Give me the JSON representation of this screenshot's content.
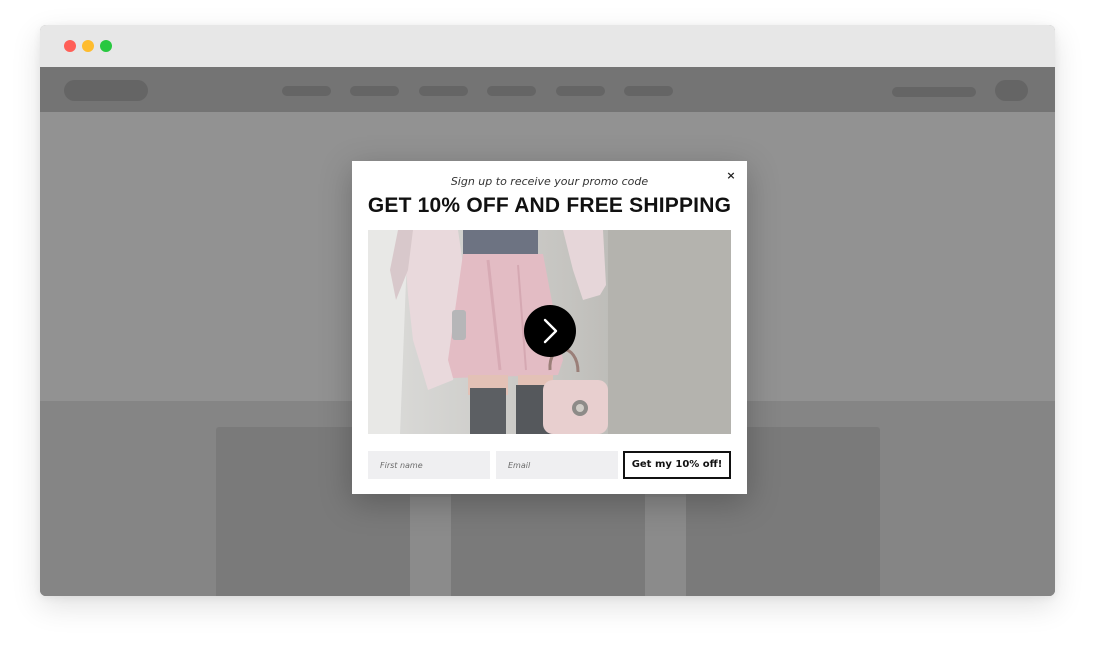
{
  "popup": {
    "subtitle": "Sign up to receive your promo code",
    "headline": "GET 10% OFF AND FREE SHIPPING",
    "close_label": "×",
    "form": {
      "first_name_placeholder": "First name",
      "email_placeholder": "Email",
      "submit_label": "Get my 10% off!"
    },
    "image_icon": "chevron-right-icon"
  },
  "colors": {
    "overlay_gray": "#8d8d8d",
    "close_red": "#ff5f57",
    "minimize_yellow": "#febc2e",
    "zoom_green": "#28c840",
    "button_border": "#111111"
  }
}
